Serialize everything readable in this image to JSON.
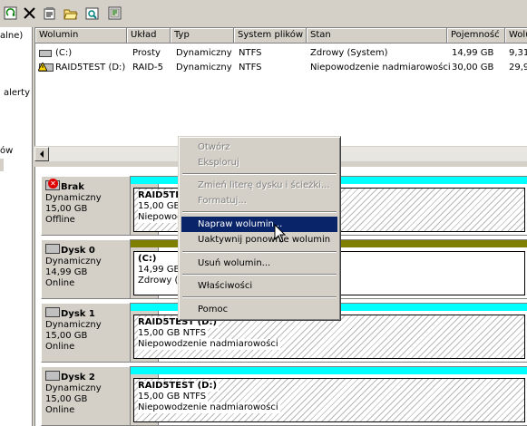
{
  "toolbar": {
    "icons": [
      "refresh-icon",
      "delete-icon",
      "properties-icon",
      "open-folder-icon",
      "explore-icon",
      "help-icon"
    ]
  },
  "left_pane": {
    "text_1": "alne)",
    "text_2": "alerty",
    "text_3": "ów"
  },
  "volume_list": {
    "columns": [
      "Wolumin",
      "Układ",
      "Typ",
      "System plików",
      "Stan",
      "Pojemność",
      "Wolu"
    ],
    "rows": [
      {
        "name": "(C:)",
        "layout": "Prosty",
        "type": "Dynamiczny",
        "fs": "NTFS",
        "status": "Zdrowy (System)",
        "capacity": "14,99 GB",
        "free": "9,31"
      },
      {
        "name": "RAID5TEST (D:)",
        "layout": "RAID-5",
        "type": "Dynamiczny",
        "fs": "NTFS",
        "status": "Niepowodzenie nadmiarowości",
        "capacity": "30,00 GB",
        "free": "29,9"
      }
    ]
  },
  "disks": [
    {
      "name": "Brak",
      "type": "Dynamiczny",
      "size": "15,00 GB",
      "state": "Offline",
      "part_title": "RAID5TES",
      "part_size": "15,00 GB",
      "part_status": "Niepowod"
    },
    {
      "name": "Dysk 0",
      "type": "Dynamiczny",
      "size": "14,99 GB",
      "state": "Online",
      "part_title": "(C:)",
      "part_size": "14,99 GB",
      "part_status": "Zdrowy (S"
    },
    {
      "name": "Dysk 1",
      "type": "Dynamiczny",
      "size": "15,00 GB",
      "state": "Online",
      "part_title": "RAID5TEST  (D:)",
      "part_size": "15,00 GB NTFS",
      "part_status": "Niepowodzenie nadmiarowości"
    },
    {
      "name": "Dysk 2",
      "type": "Dynamiczny",
      "size": "15,00 GB",
      "state": "Online",
      "part_title": "RAID5TEST  (D:)",
      "part_size": "15,00 GB NTFS",
      "part_status": "Niepowodzenie nadmiarowości"
    }
  ],
  "context_menu": {
    "open": "Otwórz",
    "explore": "Eksploruj",
    "change_letter": "Zmień literę dysku i ścieżki...",
    "format": "Formatuj...",
    "repair": "Napraw wolumin...",
    "reactivate": "Uaktywnij ponownie wolumin",
    "delete": "Usuń wolumin...",
    "properties": "Właściwości",
    "help": "Pomoc"
  },
  "colors": {
    "raid_bar": "#00ffff",
    "simple_bar": "#808000",
    "selection": "#0a246a"
  }
}
